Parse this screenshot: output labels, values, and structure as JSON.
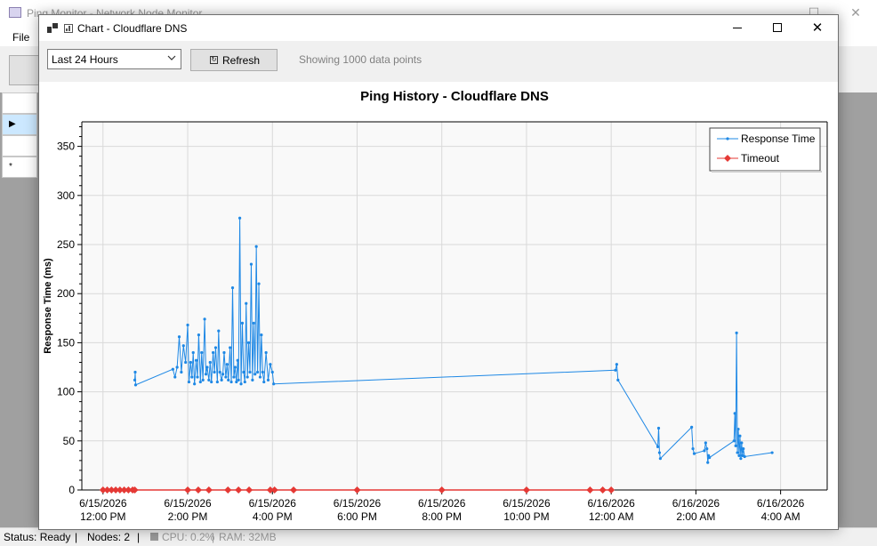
{
  "main_window": {
    "title": "Ping Monitor - Network Node Monitor",
    "menu": {
      "file": "File"
    },
    "grid": {
      "new_row_marker": "*",
      "current_row_marker": "▶"
    },
    "status": {
      "status": "Status: Ready",
      "sep": "|",
      "nodes": "Nodes: 2",
      "cpu": "CPU: 0.2%",
      "ram": "RAM: 32MB"
    }
  },
  "chart_window": {
    "title": "Chart - Cloudflare DNS",
    "range_select": {
      "value": "Last 24 Hours"
    },
    "refresh_label": "Refresh",
    "points_text": "Showing 1000 data points",
    "colors": {
      "response": "#1e88e5",
      "timeout": "#e53935"
    }
  },
  "chart_data": {
    "type": "line",
    "title": "Ping History - Cloudflare DNS",
    "xlabel": "",
    "ylabel": "Response Time (ms)",
    "ylim": [
      0,
      375
    ],
    "yticks": [
      0,
      50,
      100,
      150,
      200,
      250,
      300,
      350
    ],
    "xlim": [
      11.5,
      29.1
    ],
    "x_unit": "hours since 6/15/2026 00:00",
    "xticks": [
      {
        "x": 12,
        "label_date": "6/15/2026",
        "label_time": "12:00 PM"
      },
      {
        "x": 14,
        "label_date": "6/15/2026",
        "label_time": "2:00 PM"
      },
      {
        "x": 16,
        "label_date": "6/15/2026",
        "label_time": "4:00 PM"
      },
      {
        "x": 18,
        "label_date": "6/15/2026",
        "label_time": "6:00 PM"
      },
      {
        "x": 20,
        "label_date": "6/15/2026",
        "label_time": "8:00 PM"
      },
      {
        "x": 22,
        "label_date": "6/15/2026",
        "label_time": "10:00 PM"
      },
      {
        "x": 24,
        "label_date": "6/16/2026",
        "label_time": "12:00 AM"
      },
      {
        "x": 26,
        "label_date": "6/16/2026",
        "label_time": "2:00 AM"
      },
      {
        "x": 28,
        "label_date": "6/16/2026",
        "label_time": "4:00 AM"
      }
    ],
    "grid": true,
    "legend": "top-right",
    "series": [
      {
        "name": "Response Time",
        "style": "line-with-dots",
        "points": [
          [
            12.75,
            112
          ],
          [
            12.76,
            120
          ],
          [
            12.77,
            107
          ],
          [
            13.65,
            123
          ],
          [
            13.7,
            115
          ],
          [
            13.75,
            125
          ],
          [
            13.8,
            156
          ],
          [
            13.85,
            120
          ],
          [
            13.9,
            147
          ],
          [
            13.95,
            130
          ],
          [
            14.0,
            168
          ],
          [
            14.03,
            110
          ],
          [
            14.07,
            130
          ],
          [
            14.1,
            115
          ],
          [
            14.13,
            140
          ],
          [
            14.16,
            108
          ],
          [
            14.2,
            132
          ],
          [
            14.23,
            115
          ],
          [
            14.26,
            158
          ],
          [
            14.3,
            110
          ],
          [
            14.33,
            140
          ],
          [
            14.36,
            112
          ],
          [
            14.4,
            174
          ],
          [
            14.43,
            118
          ],
          [
            14.46,
            125
          ],
          [
            14.5,
            112
          ],
          [
            14.53,
            130
          ],
          [
            14.56,
            110
          ],
          [
            14.6,
            140
          ],
          [
            14.63,
            120
          ],
          [
            14.66,
            145
          ],
          [
            14.7,
            110
          ],
          [
            14.73,
            162
          ],
          [
            14.76,
            120
          ],
          [
            14.8,
            112
          ],
          [
            14.83,
            118
          ],
          [
            14.86,
            140
          ],
          [
            14.9,
            115
          ],
          [
            14.93,
            128
          ],
          [
            14.96,
            112
          ],
          [
            15.0,
            145
          ],
          [
            15.03,
            110
          ],
          [
            15.06,
            206
          ],
          [
            15.09,
            115
          ],
          [
            15.12,
            125
          ],
          [
            15.15,
            110
          ],
          [
            15.18,
            132
          ],
          [
            15.2,
            112
          ],
          [
            15.23,
            277
          ],
          [
            15.26,
            108
          ],
          [
            15.29,
            170
          ],
          [
            15.32,
            120
          ],
          [
            15.35,
            110
          ],
          [
            15.38,
            190
          ],
          [
            15.41,
            115
          ],
          [
            15.44,
            150
          ],
          [
            15.47,
            120
          ],
          [
            15.5,
            230
          ],
          [
            15.53,
            112
          ],
          [
            15.56,
            170
          ],
          [
            15.59,
            118
          ],
          [
            15.62,
            248
          ],
          [
            15.65,
            120
          ],
          [
            15.68,
            210
          ],
          [
            15.71,
            115
          ],
          [
            15.74,
            158
          ],
          [
            15.77,
            120
          ],
          [
            15.8,
            110
          ],
          [
            15.85,
            140
          ],
          [
            15.9,
            112
          ],
          [
            15.95,
            128
          ],
          [
            16.0,
            120
          ],
          [
            16.03,
            108
          ],
          [
            24.1,
            122
          ],
          [
            24.13,
            128
          ],
          [
            24.16,
            112
          ],
          [
            25.1,
            44
          ],
          [
            25.12,
            63
          ],
          [
            25.14,
            38
          ],
          [
            25.16,
            32
          ],
          [
            25.9,
            64
          ],
          [
            25.93,
            42
          ],
          [
            25.96,
            37
          ],
          [
            26.2,
            40
          ],
          [
            26.23,
            48
          ],
          [
            26.26,
            42
          ],
          [
            26.28,
            28
          ],
          [
            26.3,
            35
          ],
          [
            26.32,
            33
          ],
          [
            26.9,
            50
          ],
          [
            26.92,
            78
          ],
          [
            26.94,
            45
          ],
          [
            26.96,
            160
          ],
          [
            26.98,
            38
          ],
          [
            27.0,
            62
          ],
          [
            27.02,
            35
          ],
          [
            27.04,
            55
          ],
          [
            27.06,
            32
          ],
          [
            27.08,
            48
          ],
          [
            27.1,
            35
          ],
          [
            27.12,
            42
          ],
          [
            27.15,
            34
          ],
          [
            27.8,
            38
          ]
        ]
      },
      {
        "name": "Timeout",
        "style": "line-with-diamonds",
        "points": [
          [
            12.0,
            0
          ],
          [
            12.1,
            0
          ],
          [
            12.2,
            0
          ],
          [
            12.3,
            0
          ],
          [
            12.4,
            0
          ],
          [
            12.5,
            0
          ],
          [
            12.6,
            0
          ],
          [
            12.7,
            0
          ],
          [
            12.75,
            0
          ],
          [
            14.0,
            0
          ],
          [
            14.25,
            0
          ],
          [
            14.5,
            0
          ],
          [
            14.95,
            0
          ],
          [
            15.2,
            0
          ],
          [
            15.45,
            0
          ],
          [
            15.95,
            0
          ],
          [
            16.05,
            0
          ],
          [
            16.5,
            0
          ],
          [
            18.0,
            0
          ],
          [
            20.0,
            0
          ],
          [
            22.0,
            0
          ],
          [
            23.5,
            0
          ],
          [
            23.8,
            0
          ],
          [
            24.0,
            0
          ]
        ]
      }
    ]
  }
}
